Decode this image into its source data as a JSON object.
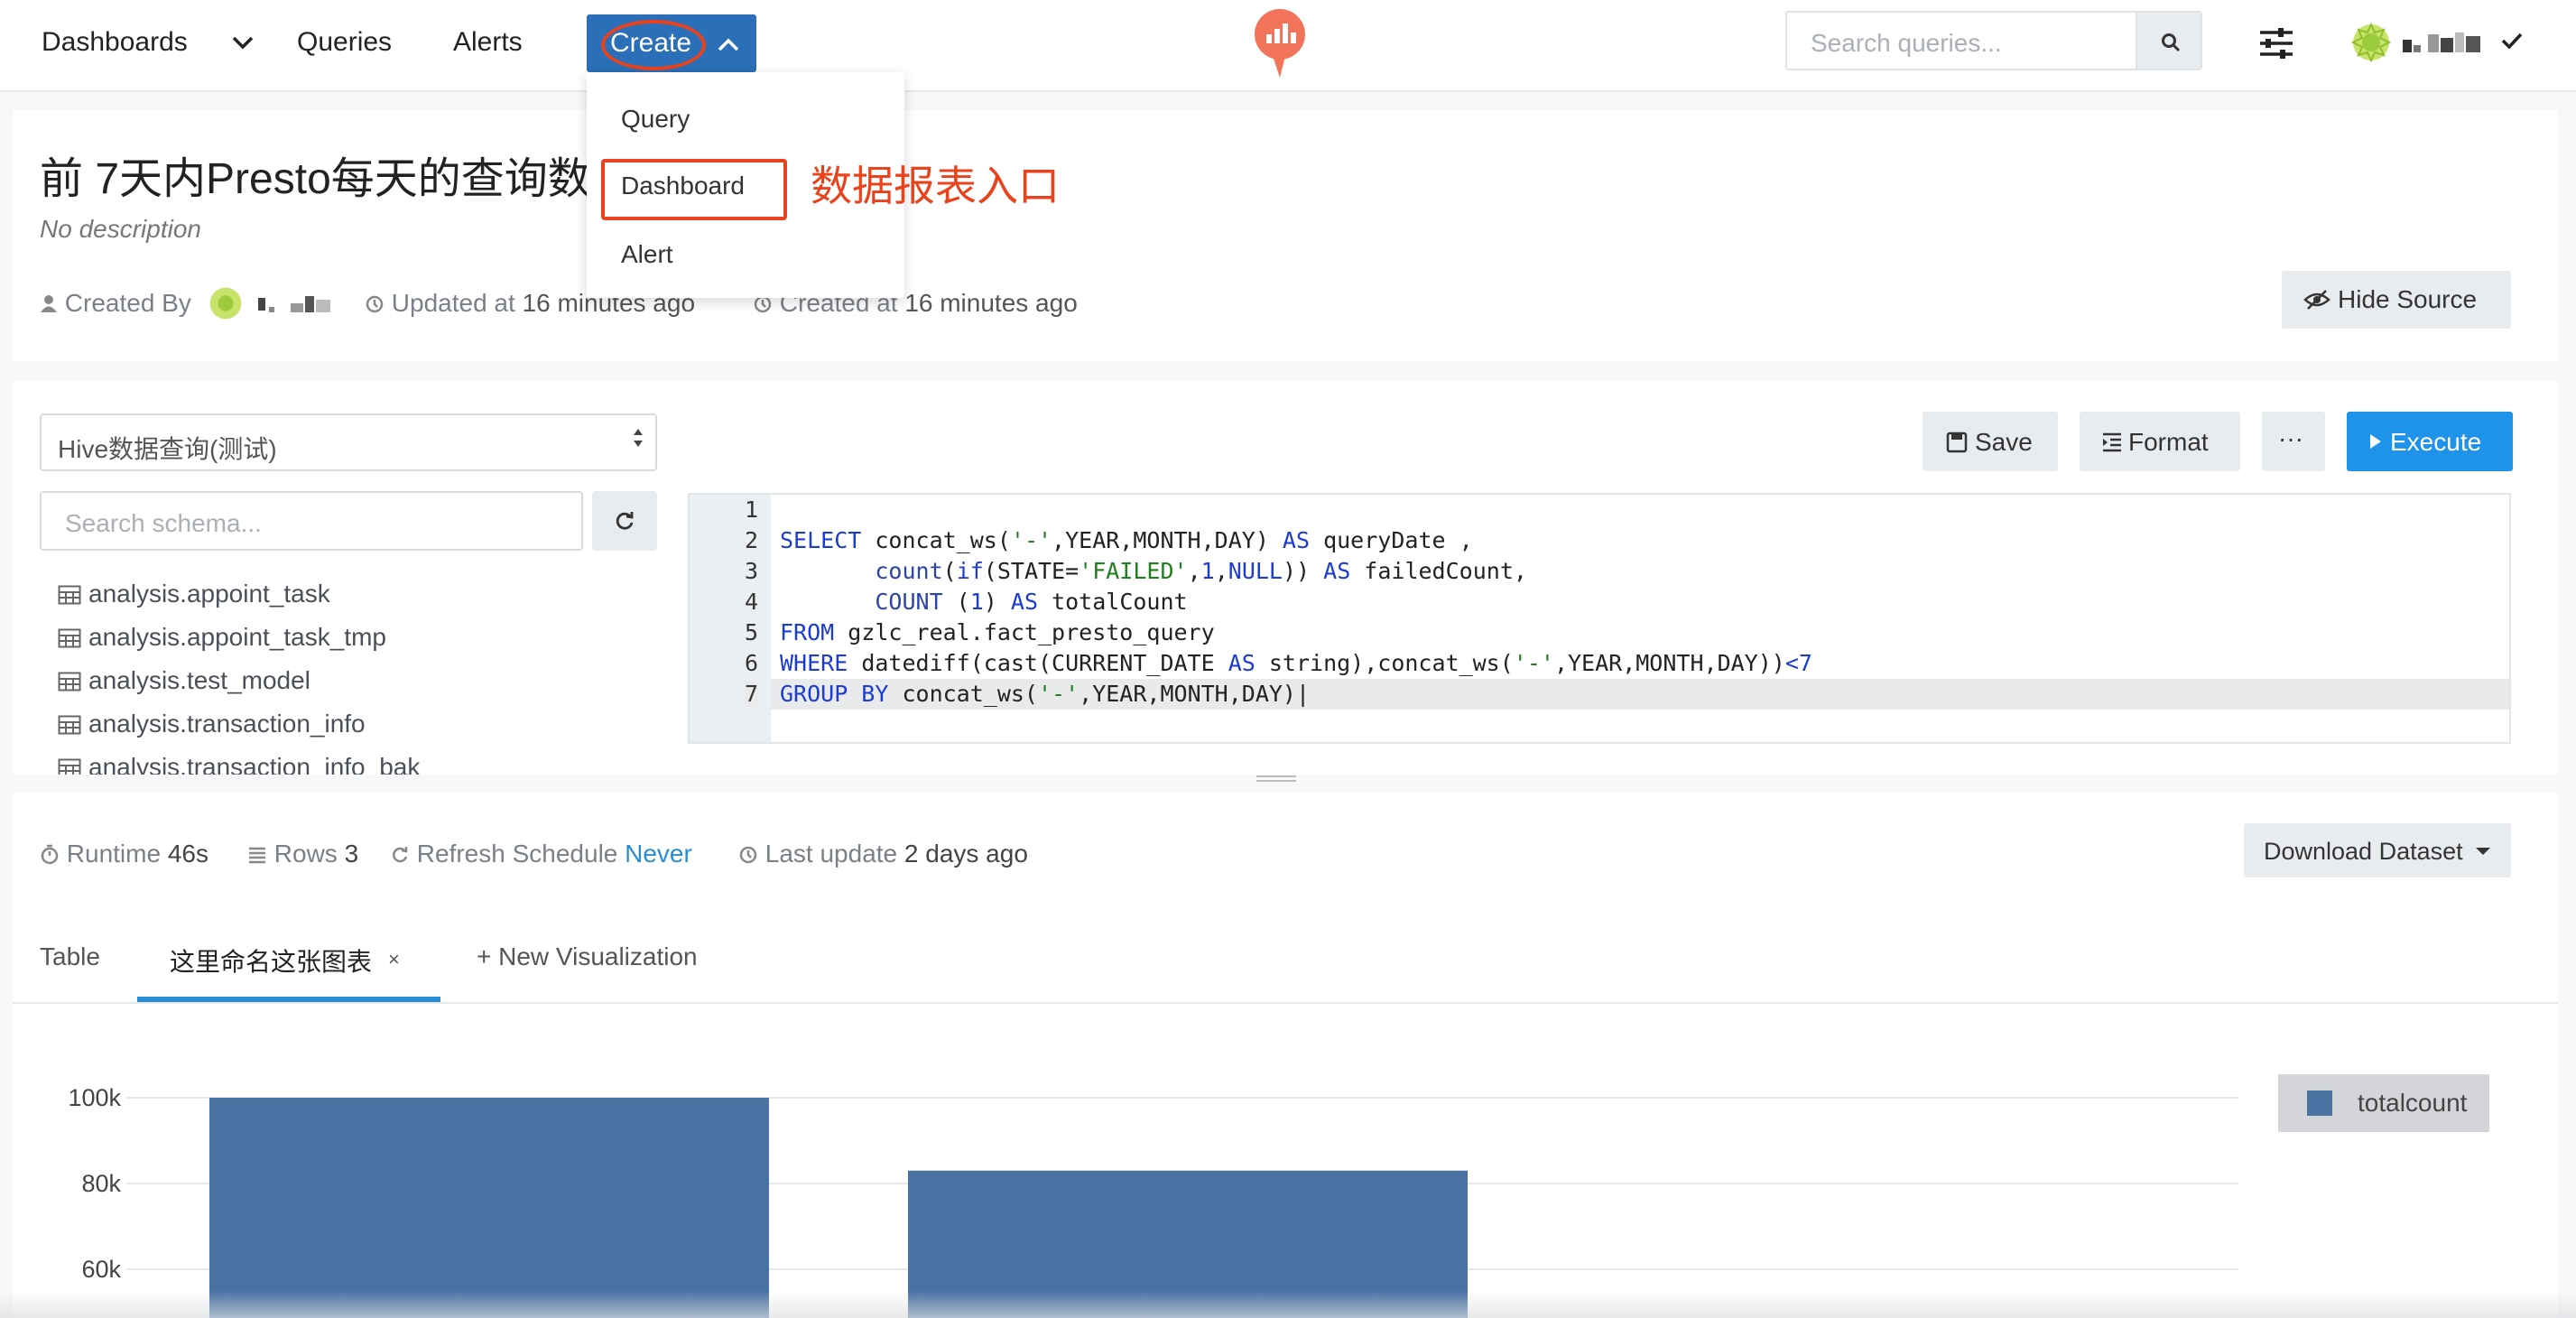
{
  "nav": {
    "dashboards": "Dashboards",
    "queries": "Queries",
    "alerts": "Alerts",
    "create": "Create",
    "search_placeholder": "Search queries..."
  },
  "create_menu": {
    "items": [
      "Query",
      "Dashboard",
      "Alert"
    ],
    "annotation": "数据报表入口"
  },
  "query": {
    "title": "前 7天内Presto每天的查询数",
    "description": "No description",
    "created_by_label": "Created By",
    "updated_label": "Updated at",
    "updated_value": "16 minutes ago",
    "created_label": "Created at",
    "created_value": "16 minutes ago",
    "hide_source": "Hide Source"
  },
  "editor": {
    "datasource": "Hive数据查询(测试)",
    "schema_search_placeholder": "Search schema...",
    "schema": [
      "analysis.appoint_task",
      "analysis.appoint_task_tmp",
      "analysis.test_model",
      "analysis.transaction_info",
      "analysis.transaction_info_bak"
    ],
    "buttons": {
      "save": "Save",
      "format": "Format",
      "more": "···",
      "execute": "Execute"
    },
    "line_numbers": [
      "1",
      "2",
      "3",
      "4",
      "5",
      "6",
      "7"
    ]
  },
  "results": {
    "runtime_label": "Runtime",
    "runtime_value": "46s",
    "rows_label": "Rows",
    "rows_value": "3",
    "refresh_label": "Refresh Schedule",
    "refresh_value": "Never",
    "last_update_label": "Last update",
    "last_update_value": "2 days ago",
    "download": "Download Dataset",
    "tabs": [
      "Table",
      "这里命名这张图表",
      "+ New Visualization"
    ],
    "tab_close": "×"
  },
  "chart_data": {
    "type": "bar",
    "series": [
      {
        "name": "totalcount",
        "values": [
          100000,
          83000,
          0
        ]
      }
    ],
    "y_ticks": [
      "100k",
      "80k",
      "60k"
    ],
    "y_tick_values": [
      100000,
      80000,
      60000
    ],
    "legend_position": "top-right",
    "bar_color": "#4a73a4",
    "grid": true
  }
}
